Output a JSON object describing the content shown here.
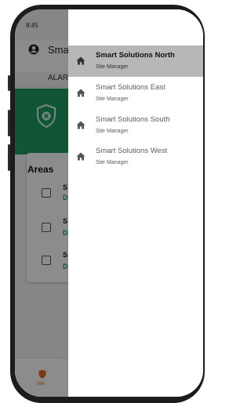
{
  "status_bar": {
    "time": "8:45",
    "icons": "▂▄▆ ≋ ▬"
  },
  "app": {
    "title": "Sma",
    "tab_label": "ALAR",
    "areas_title": "Areas",
    "rows": [
      {
        "initial": "S",
        "sub": "D"
      },
      {
        "initial": "S",
        "sub": "D"
      },
      {
        "initial": "S",
        "sub": "D"
      }
    ],
    "bottom_nav": {
      "site_label": "Site"
    }
  },
  "drawer": {
    "items": [
      {
        "name": "Smart Solutions North",
        "role": "Site Manager",
        "selected": true
      },
      {
        "name": "Smart Solutions East",
        "role": "Site Manager",
        "selected": false
      },
      {
        "name": "Smart Solutions South",
        "role": "Site Manager",
        "selected": false
      },
      {
        "name": "Smart Solutions West",
        "role": "Site Manager",
        "selected": false
      }
    ]
  },
  "colors": {
    "accent_green": "#1e9d63",
    "nav_orange": "#e06a2a",
    "selected_bg": "#b7b7b7"
  },
  "icons": {
    "account": "account-circle-icon",
    "shield": "shield-x-icon",
    "home": "home-icon",
    "site": "site-shield-icon"
  }
}
